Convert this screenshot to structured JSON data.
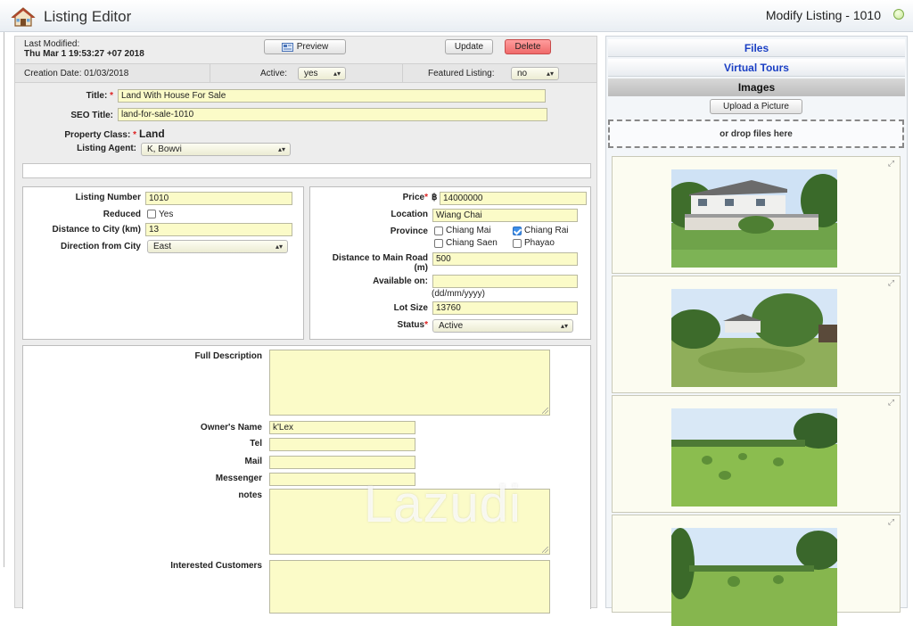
{
  "header": {
    "app_title": "Listing Editor",
    "modify_title": "Modify Listing - 1010"
  },
  "meta": {
    "last_modified_label": "Last Modified:",
    "last_modified_value": "Thu Mar 1 19:53:27 +07 2018",
    "creation_date": "Creation Date: 01/03/2018",
    "active_label": "Active:",
    "active_value": "yes",
    "featured_label": "Featured Listing:",
    "featured_value": "no"
  },
  "toolbar": {
    "preview_label": "Preview",
    "update_label": "Update",
    "delete_label": "Delete"
  },
  "general": {
    "title_label": "Title:",
    "title_value": "Land With House For Sale",
    "seo_label": "SEO Title:",
    "seo_value": "land-for-sale-1010",
    "property_class_label": "Property Class:",
    "property_class_value": "Land",
    "agent_label": "Listing Agent:",
    "agent_value": "K, Bowvi"
  },
  "left_panel": {
    "listing_number_label": "Listing Number",
    "listing_number_value": "1010",
    "reduced_label": "Reduced",
    "reduced_option": "Yes",
    "distance_city_label": "Distance to City (km)",
    "distance_city_value": "13",
    "direction_label": "Direction from City",
    "direction_value": "East"
  },
  "right_panel": {
    "price_label": "Price",
    "currency": "฿",
    "price_value": "14000000",
    "location_label": "Location",
    "location_value": "Wiang Chai",
    "province_label": "Province",
    "provinces": [
      {
        "name": "Chiang Mai",
        "checked": false
      },
      {
        "name": "Chiang Rai",
        "checked": true
      },
      {
        "name": "Chiang Saen",
        "checked": false
      },
      {
        "name": "Phayao",
        "checked": false
      }
    ],
    "main_road_label_1": "Distance to Main Road",
    "main_road_label_2": "(m)",
    "main_road_value": "500",
    "available_label": "Available on:",
    "available_value": "",
    "available_hint": "(dd/mm/yyyy)",
    "lot_size_label": "Lot Size",
    "lot_size_value": "13760",
    "status_label": "Status",
    "status_value": "Active"
  },
  "details": {
    "full_description_label": "Full Description",
    "owner_label": "Owner's Name",
    "owner_value": "k'Lex",
    "tel_label": "Tel",
    "mail_label": "Mail",
    "messenger_label": "Messenger",
    "notes_label": "notes",
    "interested_label": "Interested Customers"
  },
  "files_panel": {
    "tabs": [
      "Files",
      "Virtual Tours",
      "Images"
    ],
    "upload_label": "Upload a Picture",
    "drop_label": "or drop files here"
  },
  "watermark": "Lazudi",
  "colors": {
    "input_bg": "#fbfbc8",
    "tab_link": "#1a3fc4",
    "delete_btn": "#f06a6a",
    "form_bg": "#ededed"
  }
}
